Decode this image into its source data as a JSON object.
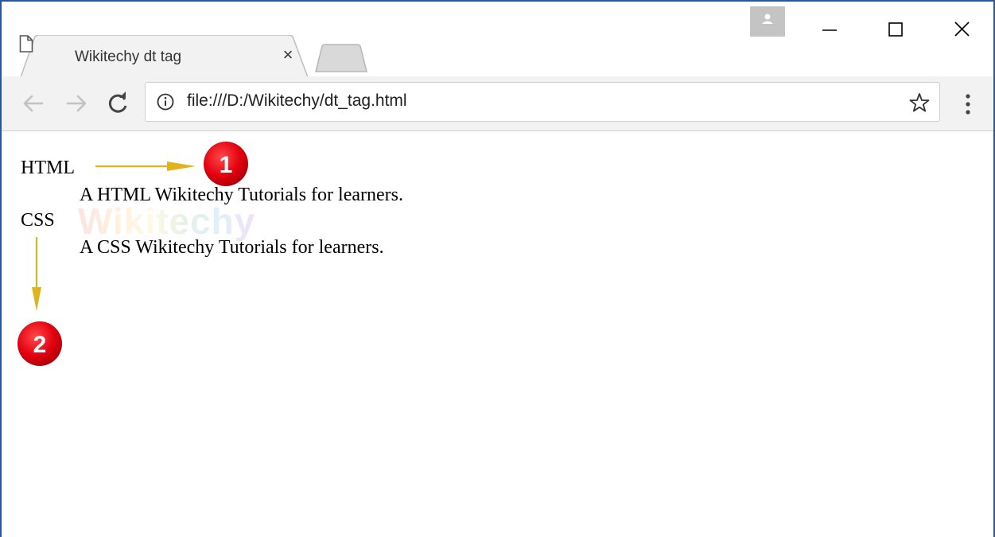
{
  "browser": {
    "tab": {
      "title": "Wikitechy dt tag",
      "close_glyph": "×"
    },
    "address_bar": {
      "url": "file:///D:/Wikitechy/dt_tag.html"
    },
    "icons": [
      "document-icon",
      "close-icon",
      "new-tab-button",
      "profile-icon",
      "minimize-icon",
      "maximize-icon",
      "window-close-icon",
      "back-arrow-icon",
      "forward-arrow-icon",
      "reload-icon",
      "info-icon",
      "star-icon",
      "menu-icon"
    ]
  },
  "page": {
    "definition_list": [
      {
        "term": "HTML",
        "description": "A HTML Wikitechy Tutorials for learners."
      },
      {
        "term": "CSS",
        "description": "A CSS Wikitechy Tutorials for learners."
      }
    ],
    "watermark": "Wikitechy"
  },
  "annotations": {
    "badges": [
      "1",
      "2"
    ],
    "arrow_color": "#e0b21c",
    "badge_color": "#e3000f"
  }
}
